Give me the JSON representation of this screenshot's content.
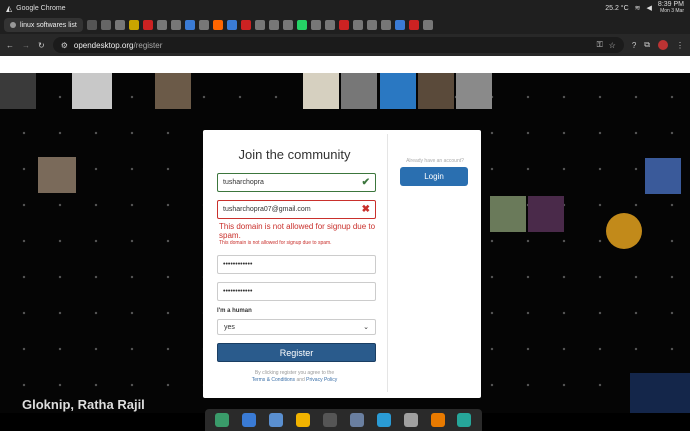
{
  "os_bar": {
    "app_name": "Google Chrome",
    "temperature": "25.2 °C",
    "time": "8:39 PM",
    "date": "Mon 3 Mar"
  },
  "tabs": {
    "active_label": "linux softwares list",
    "tab_colors": [
      "#555555",
      "#666666",
      "#777777",
      "#c9a400",
      "#cc2222",
      "#777777",
      "#777777",
      "#3a7bd5",
      "#777777",
      "#ff6600",
      "#3a7bd5",
      "#cc2222",
      "#777777",
      "#777777",
      "#777777",
      "#25d366",
      "#777777",
      "#777777",
      "#cc2222",
      "#777777",
      "#777777",
      "#777777",
      "#3a7bd5",
      "#cc2222",
      "#777777"
    ]
  },
  "address": {
    "host": "opendesktop.org",
    "path": "/register"
  },
  "modal": {
    "title": "Join the community",
    "username_value": "tusharchopra",
    "email_value": "tusharchopra07@gmail.com",
    "email_error": "This domain is not allowed for signup due to spam.",
    "email_error_small": "This domain is not allowed for signup due to spam.",
    "password_value": "••••••••••••",
    "password_confirm_value": "••••••••••••",
    "human_label": "I'm a human",
    "human_selected": "yes",
    "register_label": "Register",
    "terms_prefix": "By clicking register you agree to the",
    "terms_link": "Terms & Conditions",
    "terms_and": "and",
    "privacy_link": "Privacy Policy",
    "already_text": "Already have an account?",
    "login_label": "Login"
  },
  "background": {
    "footer_text": "Gloknip, Ratha Rajil"
  },
  "dock": {
    "icon_colors": [
      "#3a9b6a",
      "#3a7bd5",
      "#5a8fd0",
      "#f2b300",
      "#555555",
      "#6a7fa0",
      "#2a9bd5",
      "#a0a0a0",
      "#e87a00",
      "#26a69a"
    ]
  },
  "colors": {
    "accent_blue": "#2a5b8c",
    "login_blue": "#2a6fb0",
    "error_red": "#c9302c",
    "ok_green": "#3c763d"
  }
}
